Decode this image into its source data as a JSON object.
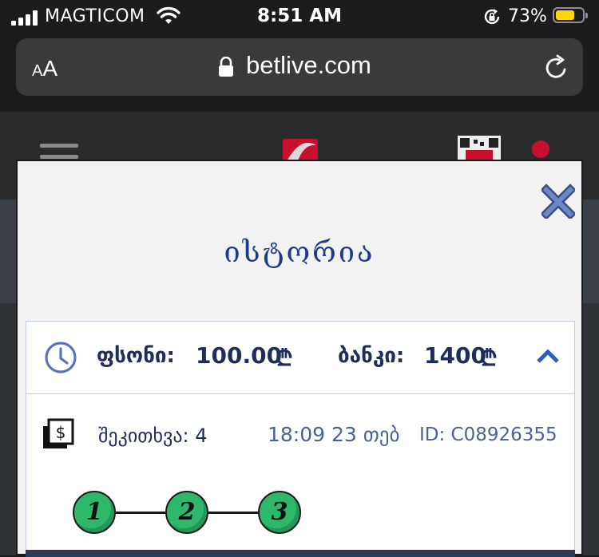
{
  "status_bar": {
    "carrier": "MAGTICOM",
    "time": "8:51 AM",
    "battery_percent": "73%",
    "battery_level": 0.73,
    "battery_color": "#ffd60a",
    "icons": [
      "signal-icon",
      "wifi-icon",
      "orientation-lock-icon",
      "battery-icon"
    ]
  },
  "browser": {
    "text_size_small": "A",
    "text_size_big": "A",
    "url": "betlive.com",
    "icons": [
      "lock-icon",
      "reload-icon"
    ]
  },
  "site_header": {
    "icons": [
      "hamburger-menu-icon",
      "site-logo-icon",
      "qr-code-icon",
      "notification-dot-icon"
    ],
    "notification_color": "#c8102e"
  },
  "modal": {
    "title": "ისტორია",
    "close_icon": "close-icon",
    "accent_color": "#1f3a8a",
    "history": {
      "stake_label": "ფსონი:",
      "stake_value": "100.00",
      "currency_symbol": "₾",
      "bank_label": "ბანკი:",
      "bank_value": "1400",
      "question": "შეკითხვა: 4",
      "datetime": "18:09 23 თებ",
      "id_text": "ID:  C08926355",
      "steps": [
        "1",
        "2",
        "3"
      ],
      "step_color": "#2db86b"
    }
  }
}
